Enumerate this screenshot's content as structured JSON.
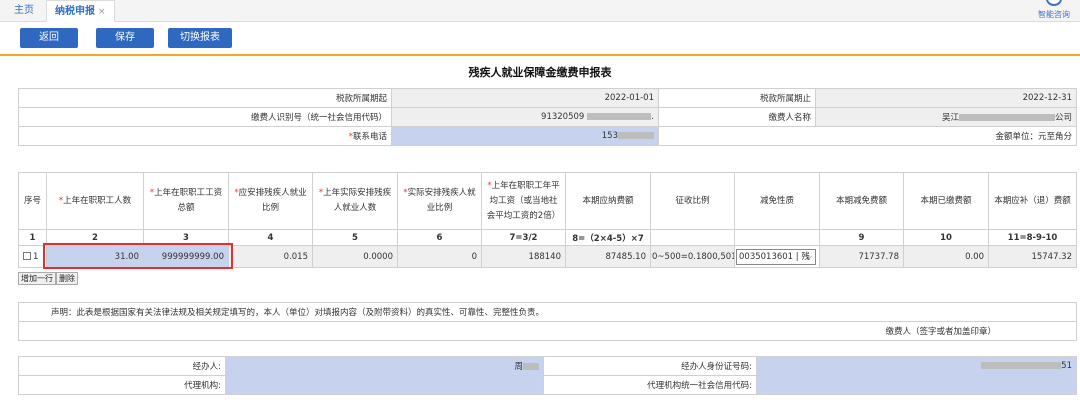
{
  "tabs": {
    "home": "主页",
    "active": "纳税申报",
    "close": "×"
  },
  "assistant": {
    "label": "智能咨询",
    "icon": "assistant-icon"
  },
  "toolbar": {
    "back": "返回",
    "save": "保存",
    "switch": "切换报表"
  },
  "title": "残疾人就业保障金缴费申报表",
  "info": {
    "period_start_label": "税款所属期起",
    "period_start": "2022-01-01",
    "period_end_label": "税款所属期止",
    "period_end": "2022-12-31",
    "payer_id_label": "缴费人识别号（统一社会信用代码）",
    "payer_id": "91320509",
    "payer_id_tail": ".",
    "payer_name_label": "缴费人名称",
    "payer_name_prefix": "吴江",
    "payer_name_suffix": "公司",
    "phone_label": "联系电话",
    "phone": "153",
    "unit_label": "金额单位：元至角分"
  },
  "table": {
    "headers": [
      "序号",
      "上年在职职工人数",
      "上年在职职工工资总额",
      "应安排残疾人就业比例",
      "上年实际安排残疾人就业人数",
      "实际安排残疾人就业比例",
      "上年在职职工年平均工资（或当地社会平均工资的2倍）",
      "本期应纳费额",
      "征收比例",
      "减免性质",
      "本期减免费额",
      "本期已缴费额",
      "本期应补（退）费额"
    ],
    "required": [
      "*",
      "*",
      "*",
      "*",
      "*",
      "*"
    ],
    "col_numbers": [
      "1",
      "2",
      "3",
      "4",
      "5",
      "6",
      "7=3/2",
      "8=（2×4-5）×7",
      "",
      "",
      "9",
      "10",
      "11=8-9-10"
    ],
    "row": {
      "index": "1",
      "employees": "31.00",
      "total_wages": "999999999.00",
      "ratio": "0.015",
      "actual_disabled": "0.0000",
      "actual_ratio": "0",
      "avg_wage": "188140",
      "payable": "87485.10",
      "levy_ratio": "0~500=0.1800,501~",
      "exemption": "0035013601 | 残",
      "reduction": "71737.78",
      "paid": "0.00",
      "refund": "15747.32"
    },
    "add_row": "增加一行",
    "delete_row": "删除"
  },
  "declaration": {
    "text": "声明：此表是根据国家有关法律法规及相关规定填写的，本人（单位）对填报内容（及附带资料）的真实性、可靠性、完整性负责。",
    "signature": "缴费人（签字或者加盖印章）"
  },
  "agent": {
    "agent_label": "经办人:",
    "agent_value": "周",
    "id_label": "经办人身份证号码:",
    "id_tail": "51",
    "org_label": "代理机构:",
    "org_code_label": "代理机构统一社会信用代码:"
  }
}
